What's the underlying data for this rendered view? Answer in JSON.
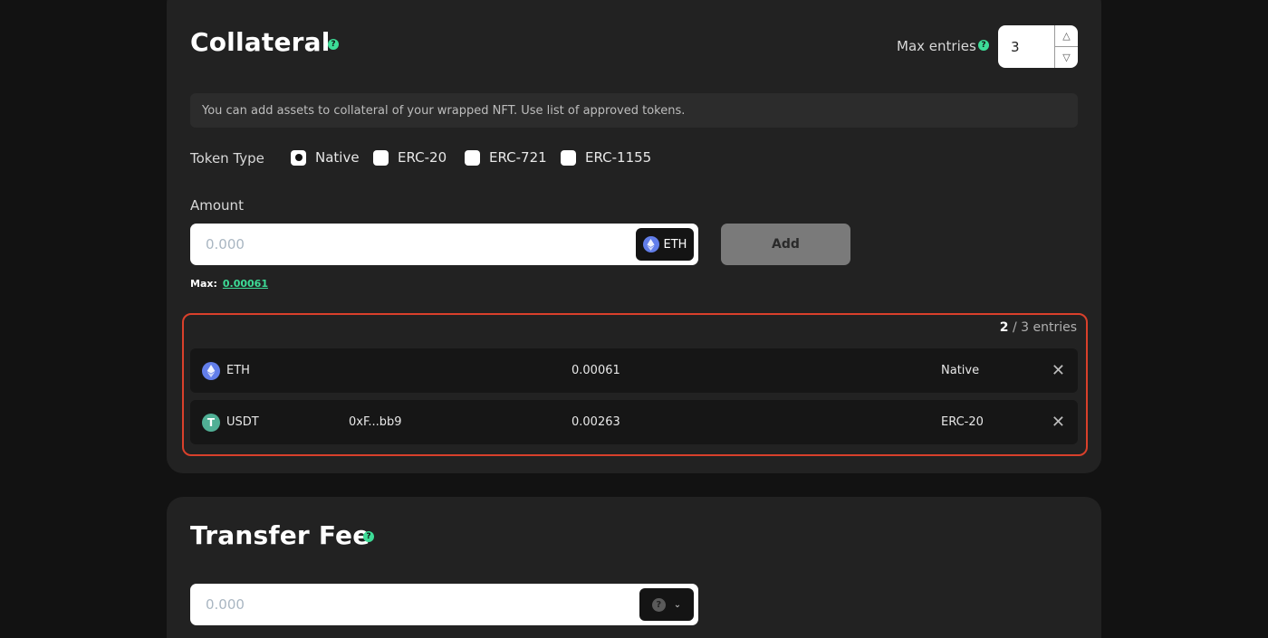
{
  "collateral": {
    "title": "Collateral",
    "help_icon": "question-icon",
    "max_entries": {
      "label": "Max entries",
      "value": "3",
      "up_icon": "chevron-up-icon",
      "down_icon": "chevron-down-icon"
    },
    "info_text": "You can add assets to collateral of your wrapped NFT. Use list of approved tokens.",
    "token_type": {
      "label": "Token Type",
      "selected": "Native",
      "options": [
        {
          "label": "Native",
          "selected": true
        },
        {
          "label": "ERC-20",
          "selected": false
        },
        {
          "label": "ERC-721",
          "selected": false
        },
        {
          "label": "ERC-1155",
          "selected": false
        }
      ]
    },
    "amount": {
      "label": "Amount",
      "placeholder": "0.000",
      "token": "ETH",
      "add_label": "Add",
      "max_label": "Max:",
      "max_value": "0.00061"
    },
    "entries": {
      "count": "2",
      "limit_text": "/ 3 entries",
      "rows": [
        {
          "token": "ETH",
          "icon": "eth-icon",
          "address": "",
          "amount": "0.00061",
          "type": "Native"
        },
        {
          "token": "USDT",
          "icon": "usdt-icon",
          "address": "0xF...bb9",
          "amount": "0.00263",
          "type": "ERC-20"
        }
      ]
    }
  },
  "transfer_fee": {
    "title": "Transfer Fee",
    "help_icon": "question-icon",
    "placeholder": "0.000",
    "token_icon": "unknown-token-icon"
  },
  "colors": {
    "background": "#121212",
    "card": "#222222",
    "accent_green": "#3ddc97",
    "highlight_border": "#d9402b",
    "add_button": "#7a7a7a"
  }
}
